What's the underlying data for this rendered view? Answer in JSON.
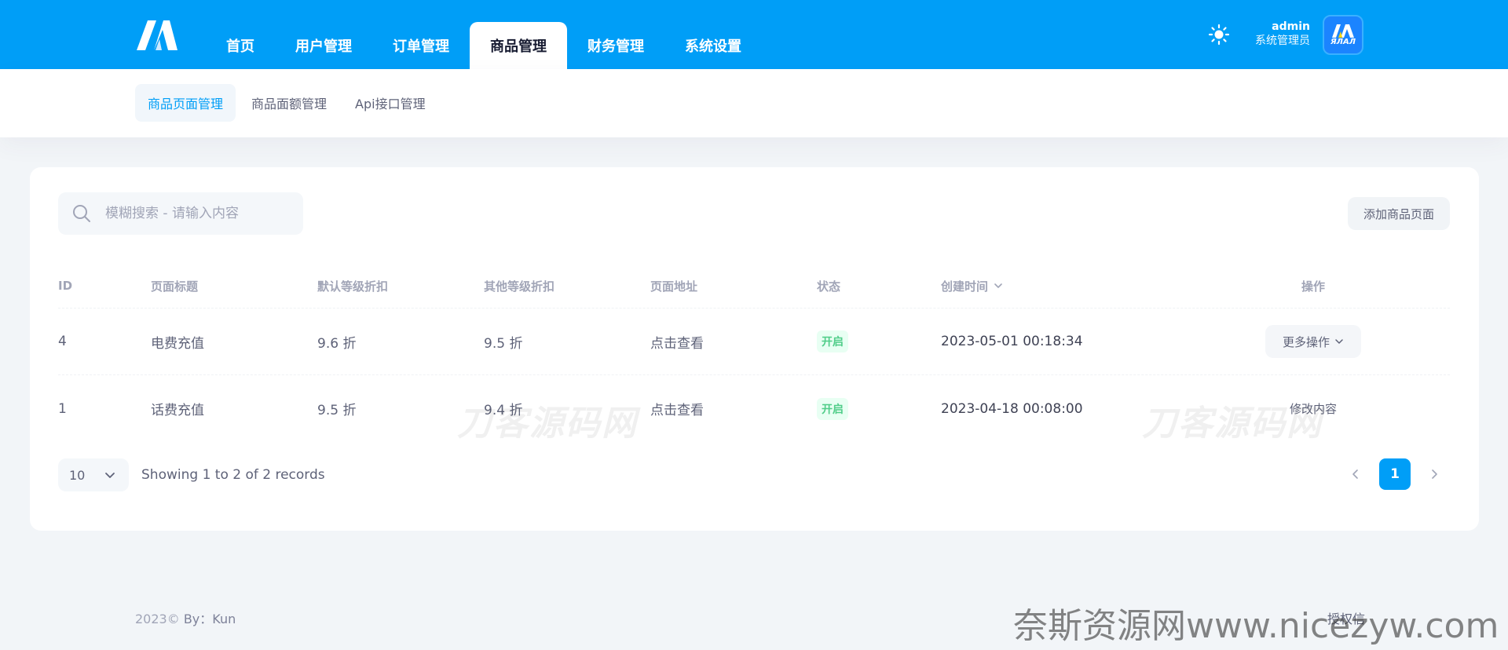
{
  "header": {
    "nav": [
      {
        "label": "首页"
      },
      {
        "label": "用户管理"
      },
      {
        "label": "订单管理"
      },
      {
        "label": "商品管理",
        "active": true
      },
      {
        "label": "财务管理"
      },
      {
        "label": "系统设置"
      }
    ],
    "user": {
      "name": "admin",
      "role": "系统管理员"
    },
    "avatar_text": "ЯЛАЛ"
  },
  "subnav": [
    {
      "label": "商品页面管理",
      "active": true
    },
    {
      "label": "商品面额管理"
    },
    {
      "label": "Api接口管理"
    }
  ],
  "toolbar": {
    "search_placeholder": "模糊搜索 - 请输入内容",
    "add_label": "添加商品页面"
  },
  "table": {
    "columns": [
      "ID",
      "页面标题",
      "默认等级折扣",
      "其他等级折扣",
      "页面地址",
      "状态",
      "创建时间",
      "操作"
    ],
    "rows": [
      {
        "id": "4",
        "title": "电费充值",
        "default_discount": "9.6 折",
        "other_discount": "9.5 折",
        "url": "点击查看",
        "status": "开启",
        "created": "2023-05-01 00:18:34",
        "action": "更多操作"
      },
      {
        "id": "1",
        "title": "话费充值",
        "default_discount": "9.5 折",
        "other_discount": "9.4 折",
        "url": "点击查看",
        "status": "开启",
        "created": "2023-04-18 00:08:00",
        "action": "修改内容"
      }
    ]
  },
  "pagination": {
    "page_size": "10",
    "summary": "Showing 1 to 2 of 2 records",
    "current_page": "1"
  },
  "watermark": "刀客源码网",
  "footer": {
    "year": "2023©",
    "by": "By：Kun",
    "link": "授权信",
    "site_mark": "奈斯资源网www.nicezyw.com"
  },
  "colors": {
    "primary": "#009ef7",
    "success": "#50cd89",
    "page_bg": "#f2f5f8"
  }
}
